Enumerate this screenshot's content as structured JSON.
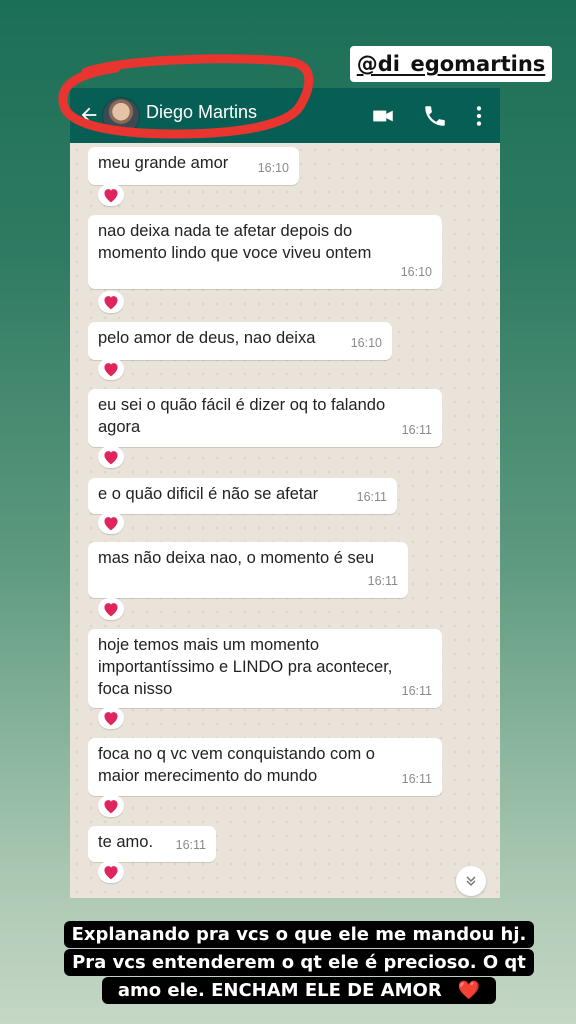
{
  "story": {
    "handle": "@di_egomartins",
    "caption_line1": "Explanando pra vcs o que ele me mandou hj.",
    "caption_line2": "Pra vcs entenderem o qt ele é precioso. O qt",
    "caption_line3": "amo ele. ENCHAM ELE DE AMOR",
    "caption_emoji": "❤️"
  },
  "chat": {
    "contact_name": "Diego Martins",
    "header_icons": [
      "back-arrow-icon",
      "video-call-icon",
      "phone-icon",
      "more-options-icon"
    ],
    "reaction": "❤️",
    "messages": [
      {
        "lines": [
          "meu grande amor"
        ],
        "time": "16:10",
        "reaction": "❤️"
      },
      {
        "lines": [
          "nao deixa nada te afetar depois do",
          "momento lindo que voce viveu ontem"
        ],
        "time": "16:10",
        "reaction": "❤️"
      },
      {
        "lines": [
          "pelo amor de deus, nao deixa"
        ],
        "time": "16:10",
        "reaction": "❤️"
      },
      {
        "lines": [
          "eu sei o quão fácil é dizer oq to falando",
          "agora"
        ],
        "time": "16:11",
        "reaction": "❤️"
      },
      {
        "lines": [
          "e o quão dificil é não se afetar"
        ],
        "time": "16:11",
        "reaction": "❤️"
      },
      {
        "lines": [
          "mas não deixa nao, o momento é seu"
        ],
        "time": "16:11",
        "reaction": "❤️"
      },
      {
        "lines": [
          "hoje temos mais um momento",
          "importantíssimo e LINDO pra acontecer,",
          "foca nisso"
        ],
        "time": "16:11",
        "reaction": "❤️"
      },
      {
        "lines": [
          "foca no q vc vem conquistando com o",
          "maior merecimento do mundo"
        ],
        "time": "16:11",
        "reaction": "❤️"
      },
      {
        "lines": [
          "te amo."
        ],
        "time": "16:11",
        "reaction": "❤️"
      }
    ]
  },
  "colors": {
    "whatsapp_header": "#075e54",
    "highlight_circle": "#e8352f",
    "heart": "#e0245e"
  }
}
